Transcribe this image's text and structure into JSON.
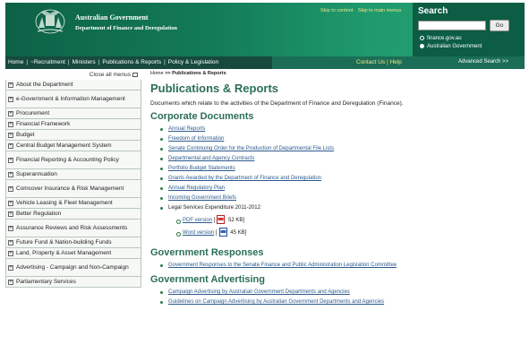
{
  "header": {
    "gov_title": "Australian Government",
    "dept_title": "Department of Finance and Deregulation",
    "skip_content": "Skip to content",
    "skip_menus": "Skip to main menus"
  },
  "search": {
    "title": "Search",
    "go_label": "Go",
    "option1": "finance.gov.au",
    "option2": "Australian Government",
    "advanced": "Advanced Search >>"
  },
  "nav": {
    "items": [
      "Home",
      "~Recruitment",
      "Ministers",
      "Publications & Reports",
      "Policy & Legislation"
    ],
    "contact": "Contact Us",
    "help": "Help"
  },
  "sidebar": {
    "close_all": "Close all menus",
    "items": [
      "About the Department",
      "e-Government & Information Management",
      "Procurement",
      "Financial Framework",
      "Budget",
      "Central Budget Management System",
      "Financial Reporting & Accounting Policy",
      "Superannuation",
      "Comcover Insurance & Risk Management",
      "Vehicle Leasing & Fleet Management",
      "Better Regulation",
      "Assurance Reviews and Risk Assessments",
      "Future Fund & Nation-building Funds",
      "Land, Property & Asset Management",
      "Advertising - Campaign and Non-Campaign",
      "Parliamentary Services"
    ]
  },
  "main": {
    "breadcrumb_home": "Home",
    "breadcrumb_sep": " >> ",
    "breadcrumb_current": "Publications & Reports",
    "title": "Publications & Reports",
    "intro": "Documents which relate to the activities of the Department of Finance and Deregulation (Finance).",
    "corporate": {
      "heading": "Corporate Documents",
      "links": [
        "Annual Reports",
        "Freedom of Information",
        "Senate Continuing Order for the Production of Departmental File Lists",
        "Departmental and Agency Contracts",
        "Portfolio Budget Statements",
        "Grants Awarded by the Department of Finance and Deregulation",
        "Annual Regulatory Plan",
        "Incoming Government Briefs"
      ],
      "legal": "Legal Services Expenditure 2011-2012",
      "pdf_link": "PDF version",
      "pdf_size": "52 KB]",
      "word_link": "Word version",
      "word_size": "45 KB]"
    },
    "responses": {
      "heading": "Government Responses",
      "links": [
        "Government Responses to the Senate Finance and Public Administration Legislation Committee"
      ]
    },
    "advertising": {
      "heading": "Government Advertising",
      "links": [
        "Campaign Advertising by Australian Government Departments and Agencies",
        "Guidelines on Campaign Advertising by Australian Government Departments and Agencies"
      ]
    }
  }
}
